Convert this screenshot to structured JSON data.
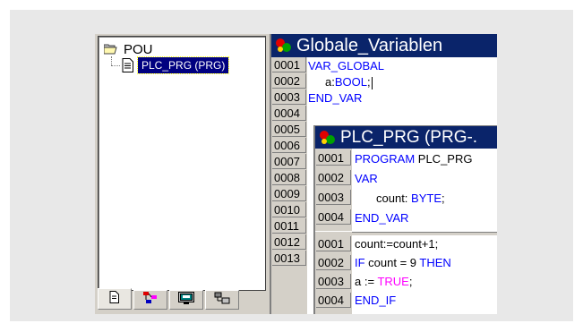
{
  "tree": {
    "root_label": "POU",
    "child_label": "PLC_PRG (PRG)"
  },
  "tabs": [
    {
      "name": "tab-pous",
      "icon": "document-icon"
    },
    {
      "name": "tab-datatypes",
      "icon": "datatype-icon"
    },
    {
      "name": "tab-visualizations",
      "icon": "visualization-icon"
    },
    {
      "name": "tab-resources",
      "icon": "resources-icon"
    }
  ],
  "globale": {
    "title": "Globale_Variablen",
    "gutter": [
      "0001",
      "0002",
      "0003",
      "0004",
      "0005",
      "0006",
      "0007",
      "0008",
      "0009",
      "0010",
      "0011",
      "0012",
      "0013"
    ],
    "lines": [
      {
        "no": "0001",
        "text": "VAR_GLOBAL"
      },
      {
        "no": "0002",
        "text_a": "a:",
        "text_b": "BOOL",
        "text_c": ";"
      },
      {
        "no": "0003",
        "text": "END_VAR"
      }
    ]
  },
  "plc": {
    "title": "PLC_PRG (PRG-.",
    "decl": [
      {
        "no": "0001",
        "kw": "PROGRAM",
        "rest": " PLC_PRG"
      },
      {
        "no": "0002",
        "kw": "VAR"
      },
      {
        "no": "0003",
        "name": "count: ",
        "type": "BYTE",
        "end": ";"
      },
      {
        "no": "0004",
        "kw": "END_VAR"
      }
    ],
    "body": [
      {
        "no": "0001",
        "text": "count:=count+1;"
      },
      {
        "no": "0002",
        "kw1": "IF",
        "mid": " count = 9 ",
        "kw2": "THEN"
      },
      {
        "no": "0003",
        "pre": "a := ",
        "val": "TRUE",
        "end": ";"
      },
      {
        "no": "0004",
        "kw": "END_IF"
      }
    ]
  },
  "colors": {
    "titlebar": "#0a246a",
    "keyword": "#0000ff",
    "boolean_literal": "#ff00ff",
    "selection": "#000080"
  }
}
